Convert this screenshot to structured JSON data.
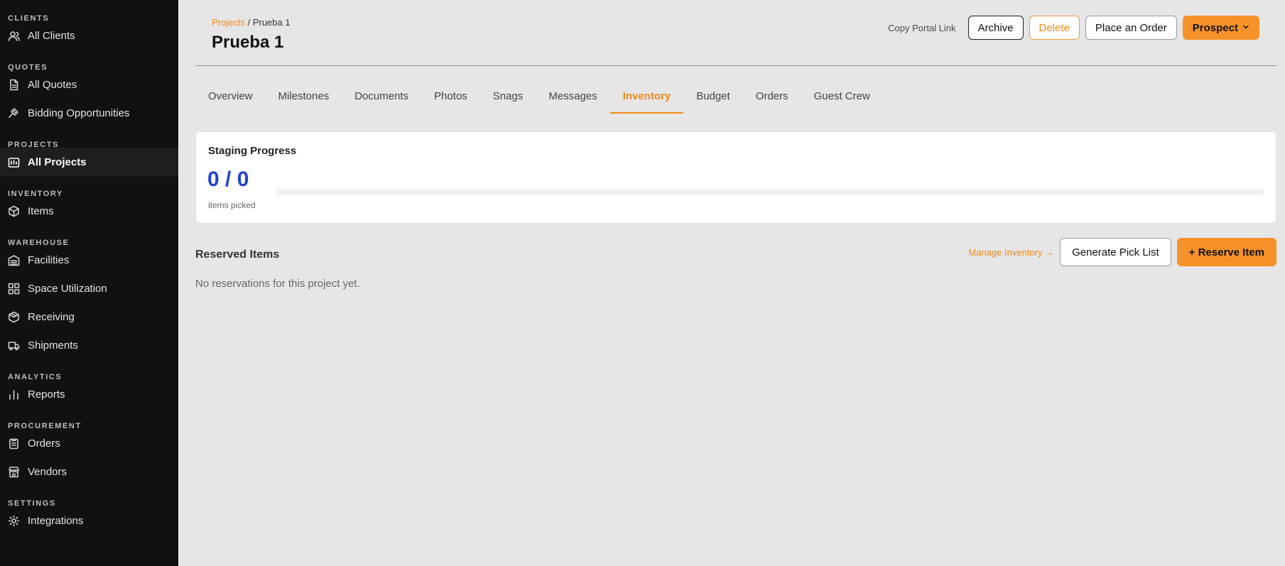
{
  "sidebar": {
    "sections": [
      {
        "label": "CLIENTS",
        "items": [
          {
            "label": "All Clients",
            "icon": "users-icon",
            "active": false
          }
        ]
      },
      {
        "label": "QUOTES",
        "items": [
          {
            "label": "All Quotes",
            "icon": "document-icon",
            "active": false
          },
          {
            "label": "Bidding Opportunities",
            "icon": "gavel-icon",
            "active": false
          }
        ]
      },
      {
        "label": "PROJECTS",
        "items": [
          {
            "label": "All Projects",
            "icon": "projects-icon",
            "active": true
          }
        ]
      },
      {
        "label": "INVENTORY",
        "items": [
          {
            "label": "Items",
            "icon": "box-icon",
            "active": false
          }
        ]
      },
      {
        "label": "WAREHOUSE",
        "items": [
          {
            "label": "Facilities",
            "icon": "warehouse-icon",
            "active": false
          },
          {
            "label": "Space Utilization",
            "icon": "grid-icon",
            "active": false
          },
          {
            "label": "Receiving",
            "icon": "package-icon",
            "active": false
          },
          {
            "label": "Shipments",
            "icon": "truck-icon",
            "active": false
          }
        ]
      },
      {
        "label": "ANALYTICS",
        "items": [
          {
            "label": "Reports",
            "icon": "bar-chart-icon",
            "active": false
          }
        ]
      },
      {
        "label": "PROCUREMENT",
        "items": [
          {
            "label": "Orders",
            "icon": "clipboard-icon",
            "active": false
          },
          {
            "label": "Vendors",
            "icon": "store-icon",
            "active": false
          }
        ]
      },
      {
        "label": "SETTINGS",
        "items": [
          {
            "label": "Integrations",
            "icon": "gear-icon",
            "active": false
          }
        ]
      }
    ]
  },
  "header": {
    "breadcrumb_link": "Projects",
    "breadcrumb_sep": " / ",
    "breadcrumb_current": "Prueba 1",
    "title": "Prueba 1",
    "copy_portal_link": "Copy Portal Link",
    "archive": "Archive",
    "delete": "Delete",
    "place_order": "Place an Order",
    "status": "Prospect"
  },
  "tabs": [
    {
      "label": "Overview",
      "active": false
    },
    {
      "label": "Milestones",
      "active": false
    },
    {
      "label": "Documents",
      "active": false
    },
    {
      "label": "Photos",
      "active": false
    },
    {
      "label": "Snags",
      "active": false
    },
    {
      "label": "Messages",
      "active": false
    },
    {
      "label": "Inventory",
      "active": true
    },
    {
      "label": "Budget",
      "active": false
    },
    {
      "label": "Orders",
      "active": false
    },
    {
      "label": "Guest Crew",
      "active": false
    }
  ],
  "staging": {
    "title": "Staging Progress",
    "count": "0 / 0",
    "caption": "items picked",
    "progress_percent": 0
  },
  "reserved": {
    "title": "Reserved Items",
    "manage": "Manage Inventory →",
    "generate": "Generate Pick List",
    "reserve": "+ Reserve Item",
    "empty": "No reservations for this project yet."
  },
  "colors": {
    "accent": "#f7922b",
    "progress_blue": "#1f45c8",
    "sidebar_bg": "#111111"
  }
}
